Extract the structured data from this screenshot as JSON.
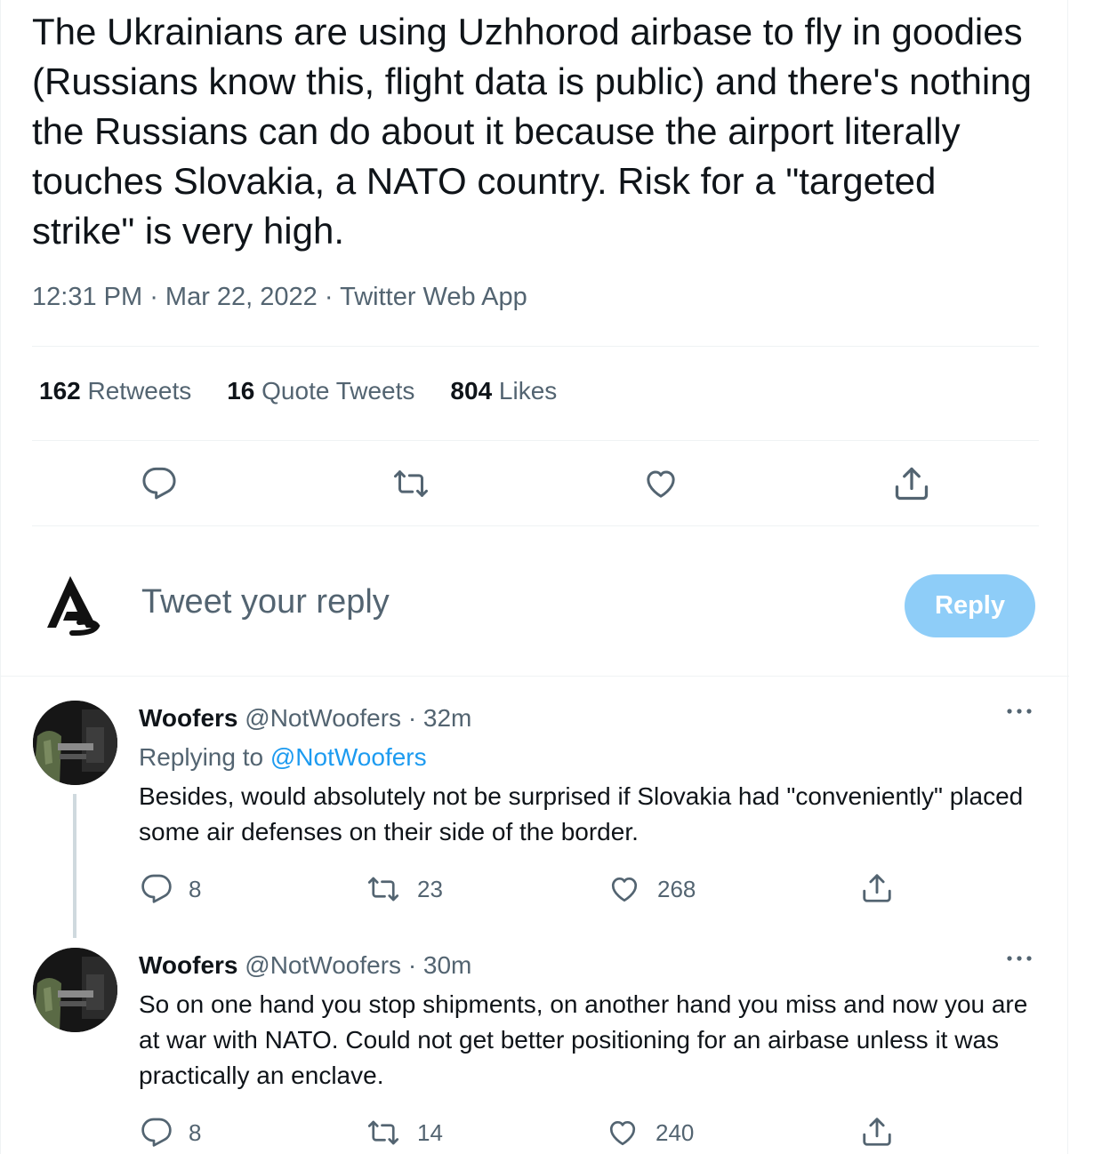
{
  "tweet": {
    "text": "The Ukrainians are using Uzhhorod airbase to fly in goodies (Russians know this, flight data is public) and there's nothing the Russians can do about it because the airport literally touches Slovakia, a NATO country. Risk for a \"targeted strike\" is very high.",
    "time": "12:31 PM",
    "date": "Mar 22, 2022",
    "source": "Twitter Web App",
    "stats": {
      "retweets_count": "162",
      "retweets_label": "Retweets",
      "quotes_count": "16",
      "quotes_label": "Quote Tweets",
      "likes_count": "804",
      "likes_label": "Likes"
    }
  },
  "composer": {
    "placeholder": "Tweet your reply",
    "button_label": "Reply"
  },
  "replies": [
    {
      "name": "Woofers",
      "handle": "@NotWoofers",
      "time": "· 32m",
      "replying_prefix": "Replying to",
      "replying_to": "@NotWoofers",
      "text": "Besides, would absolutely not be surprised if Slovakia had \"conveniently\" placed some air defenses on their side of the border.",
      "reply_count": "8",
      "retweet_count": "23",
      "like_count": "268"
    },
    {
      "name": "Woofers",
      "handle": "@NotWoofers",
      "time": "· 30m",
      "text": "So on one hand you stop shipments, on another hand you miss and now you are at war with NATO. Could not get better positioning for an airbase unless it was practically an enclave.",
      "reply_count": "8",
      "retweet_count": "14",
      "like_count": "240"
    }
  ],
  "icons": {
    "reply": "reply-icon",
    "retweet": "retweet-icon",
    "like": "heart-icon",
    "share": "share-icon",
    "more": "more-icon"
  },
  "colors": {
    "accent": "#1d9bf0",
    "reply_button": "#8ecdf8",
    "muted": "#536471"
  }
}
